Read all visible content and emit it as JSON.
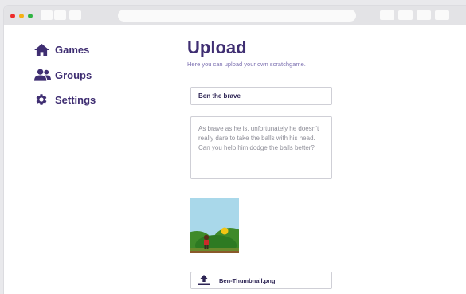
{
  "sidebar": {
    "items": [
      {
        "label": "Games",
        "icon": "home-icon"
      },
      {
        "label": "Groups",
        "icon": "users-icon"
      },
      {
        "label": "Settings",
        "icon": "gear-icon"
      }
    ]
  },
  "main": {
    "title": "Upload",
    "subtitle": "Here you can upload your own scratchgame.",
    "game_title_value": "Ben the brave",
    "description_value": "As brave as he is, unfortunately he doesn’t really dare to take the balls with his head. Can you help him dodge the balls better?",
    "thumbnail_file": "Ben-Thumbnail.png"
  },
  "colors": {
    "brand": "#3f2e72",
    "accent": "#7b6fb0",
    "border": "#cfcfd6"
  }
}
